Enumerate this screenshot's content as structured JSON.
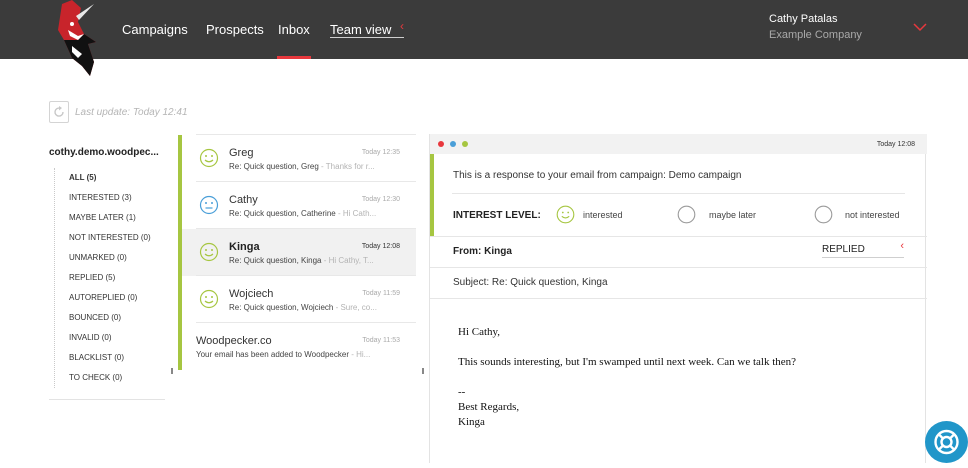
{
  "nav": {
    "campaigns": "Campaigns",
    "prospects": "Prospects",
    "inbox": "Inbox",
    "team_view": "Team view"
  },
  "user": {
    "name": "Cathy Patalas",
    "company": "Example Company"
  },
  "last_update": "Last update: Today 12:41",
  "account": "cothy.demo.woodpec...",
  "filters": [
    {
      "label": "ALL (5)"
    },
    {
      "label": "INTERESTED (3)"
    },
    {
      "label": "MAYBE LATER (1)"
    },
    {
      "label": "NOT INTERESTED (0)"
    },
    {
      "label": "UNMARKED (0)"
    },
    {
      "label": "REPLIED (5)"
    },
    {
      "label": "AUTOREPLIED (0)"
    },
    {
      "label": "BOUNCED (0)"
    },
    {
      "label": "INVALID (0)"
    },
    {
      "label": "BLACKLIST (0)"
    },
    {
      "label": "TO CHECK (0)"
    }
  ],
  "messages": [
    {
      "sender": "Greg",
      "time": "Today 12:35",
      "subject": "Re: Quick question, Greg",
      "snippet": " - Thanks for r...",
      "face": "happy"
    },
    {
      "sender": "Cathy",
      "time": "Today 12:30",
      "subject": "Re: Quick question, Catherine",
      "snippet": " - Hi Cath...",
      "face": "neutral"
    },
    {
      "sender": "Kinga",
      "time": "Today 12:08",
      "subject": "Re: Quick question, Kinga",
      "snippet": " - Hi Cathy, T...",
      "face": "happy"
    },
    {
      "sender": "Wojciech",
      "time": "Today 11:59",
      "subject": "Re: Quick question, Wojciech",
      "snippet": " - Sure, co...",
      "face": "happy"
    },
    {
      "sender": "Woodpecker.co",
      "time": "Today 11:53",
      "subject": "Your email has been added to Woodpecker",
      "snippet": " - Hi...",
      "face": "none"
    }
  ],
  "detail": {
    "time": "Today 12:08",
    "response_text": "This is a response to your email from campaign: Demo campaign",
    "interest_label": "INTEREST LEVEL:",
    "options": {
      "interested": "interested",
      "maybe_later": "maybe later",
      "not_interested": "not interested"
    },
    "from": "From: Kinga",
    "status": "REPLIED",
    "subject": "Subject: Re: Quick question, Kinga",
    "body": {
      "greeting": "Hi Cathy,",
      "text": "This sounds interesting, but I'm swamped until next week. Can we talk then?",
      "dashes": "--",
      "regards": "Best Regards,",
      "signature": "Kinga"
    }
  },
  "colors": {
    "accent_red": "#e8383d",
    "accent_green": "#a6c641",
    "help_blue": "#2196c9",
    "topbar": "#3b3b3b"
  }
}
